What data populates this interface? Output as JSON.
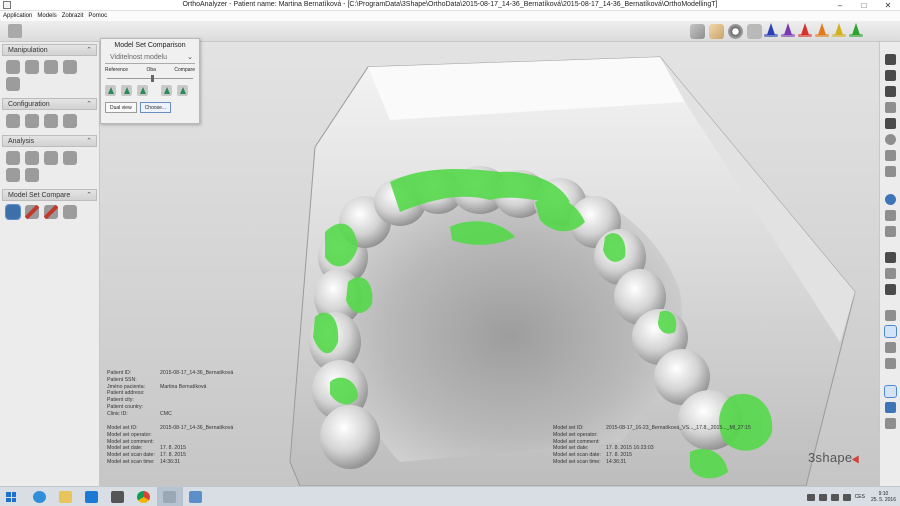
{
  "window": {
    "title": "OrthoAnalyzer - Patient name: Martina Bernatíková - [C:\\ProgramData\\3Shape\\OrthoData\\2015-08-17_14-36_Bernatíková\\2015-08-17_14-36_Bernatíková\\OrthoModellingT]",
    "min_label": "–",
    "max_label": "□",
    "close_label": "✕"
  },
  "menu": [
    "Application",
    "Models",
    "Zobrazit",
    "Pomoc"
  ],
  "left_panel": {
    "sections": [
      {
        "title": "Manipulation",
        "icons": [
          "rotate-icon",
          "model-icon",
          "cut-icon",
          "split-icon",
          "bracket-icon"
        ]
      },
      {
        "title": "Configuration",
        "icons": [
          "occlusion-icon",
          "jaw-icon",
          "tooth-icon",
          "tooth-icon"
        ]
      },
      {
        "title": "Analysis",
        "icons": [
          "ruler-icon",
          "measure-icon",
          "angle-icon",
          "space-icon",
          "bolton-icon",
          "arch-icon"
        ]
      },
      {
        "title": "Model Set Compare",
        "icons": [
          "compare-icon",
          "magnet-icon",
          "superimpose-icon",
          "model-pair-icon"
        ]
      }
    ]
  },
  "comparison_popup": {
    "title": "Model Set Comparison",
    "dropdown_value": "Viditelnost modelu",
    "labels": {
      "left": "Reference",
      "mid": "Oba",
      "right": "Compare"
    },
    "slider_position": 0.5,
    "buttons": {
      "dual_view": "Dual view",
      "choose": "Choose..."
    }
  },
  "patient_info": {
    "rows": [
      {
        "label": "Patient ID:",
        "value": "2015-08-17_14-36_Bernatíková"
      },
      {
        "label": "Patient SSN:",
        "value": ""
      },
      {
        "label": "Jméno pacienta:",
        "value": "Martina Bernatíková"
      },
      {
        "label": "Patient address:",
        "value": ""
      },
      {
        "label": "Patient city:",
        "value": ""
      },
      {
        "label": "Patient country:",
        "value": ""
      },
      {
        "label": "Clinic ID:",
        "value": "CMC"
      }
    ]
  },
  "model_info_left": {
    "rows": [
      {
        "label": "Model set ID:",
        "value": "2015-08-17_14-36_Bernatíková"
      },
      {
        "label": "Model set operator:",
        "value": ""
      },
      {
        "label": "Model set comment:",
        "value": ""
      },
      {
        "label": "Model set date:",
        "value": "17. 8. 2015"
      },
      {
        "label": "Model set scan date:",
        "value": "17. 8. 2015"
      },
      {
        "label": "Model set scan time:",
        "value": "14:36:31"
      }
    ]
  },
  "model_info_right": {
    "rows": [
      {
        "label": "Model set ID:",
        "value": "2015-08-17_16-23_Bernatíková_VS..._17.8._2015..._Ml_27:15"
      },
      {
        "label": "Model set operator:",
        "value": ""
      },
      {
        "label": "Model set comment:",
        "value": ""
      },
      {
        "label": "Model set date:",
        "value": "17. 8. 2015 16:23:03"
      },
      {
        "label": "Model set scan date:",
        "value": "17. 8. 2015"
      },
      {
        "label": "Model set scan time:",
        "value": "14:36:31"
      }
    ]
  },
  "brand": {
    "logo_text": "3shape"
  },
  "colors": {
    "model_gray": "#c9c9c9",
    "overlay_green": "#55d94a",
    "accent_blue": "#1e6fd0",
    "brand_red": "#d0433a"
  },
  "taskbar": {
    "apps": [
      "file-explorer-icon",
      "internet-explorer-icon",
      "folder-icon",
      "teamviewer-icon",
      "camera-icon",
      "chrome-icon",
      "orthoanalyzer-icon",
      "image-viewer-icon"
    ],
    "language": "CES",
    "time": "9:10",
    "date": "25. 5. 2016"
  }
}
